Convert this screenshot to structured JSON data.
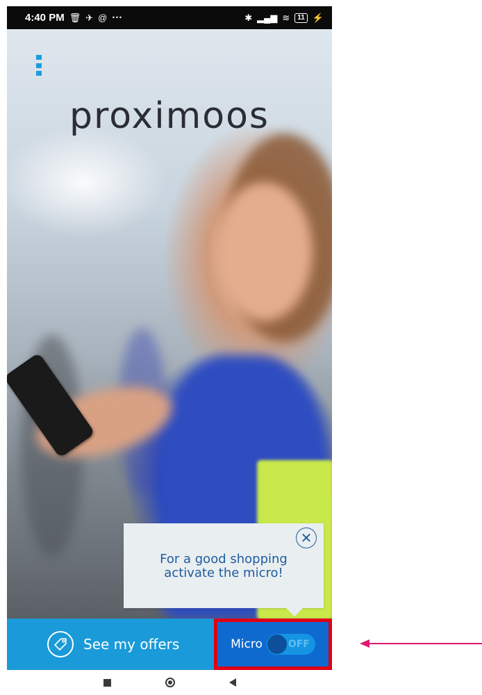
{
  "status_bar": {
    "time": "4:40 PM",
    "left_icons": [
      "trash-icon",
      "pin-icon",
      "at-icon"
    ],
    "more": "···",
    "battery": "11"
  },
  "app": {
    "logo_text": "proximoos"
  },
  "tooltip": {
    "close_symbol": "✕",
    "text_line1": "For a good shopping",
    "text_line2": "activate the micro!"
  },
  "bottom_bar": {
    "offers_label": "See my offers",
    "micro_label": "Micro",
    "micro_toggle_state": "OFF"
  },
  "colors": {
    "offers_bg": "#1a9ad8",
    "micro_bg": "#0f6ad0",
    "highlight_border": "#e00014",
    "annotation_arrow": "#e0186e"
  }
}
